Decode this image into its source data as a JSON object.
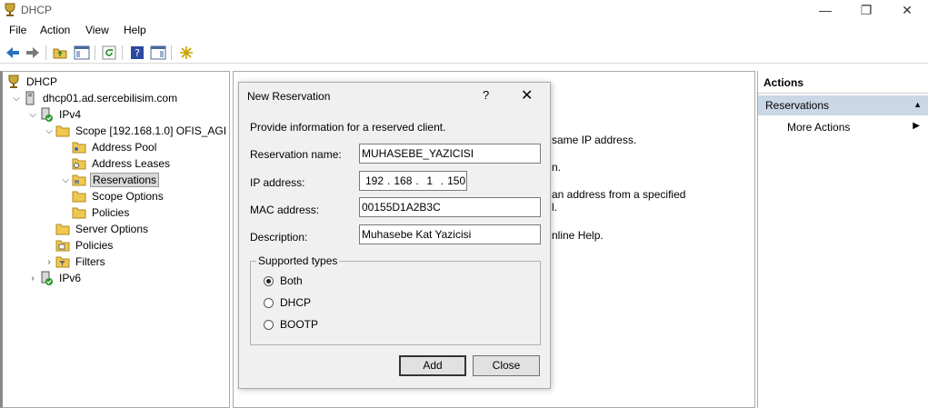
{
  "window": {
    "title": "DHCP",
    "minimize": "—",
    "maximize": "❐",
    "close": "✕"
  },
  "menu": [
    "File",
    "Action",
    "View",
    "Help"
  ],
  "toolbar": [
    "back-icon",
    "forward-icon",
    "up-folder-icon",
    "show-hide-tree-icon",
    "refresh-icon",
    "help-icon",
    "show-hide-action-pane-icon",
    "new-star-icon"
  ],
  "tree": {
    "root": "DHCP",
    "server": "dhcp01.ad.sercebilisim.com",
    "ipv4": "IPv4",
    "scope": "Scope [192.168.1.0] OFIS_AGI",
    "address_pool": "Address Pool",
    "address_leases": "Address Leases",
    "reservations": "Reservations",
    "scope_options": "Scope Options",
    "policies_scope": "Policies",
    "server_options": "Server Options",
    "policies": "Policies",
    "filters": "Filters",
    "ipv6": "IPv6"
  },
  "center_text": {
    "line1": "same IP address.",
    "line2": "n.",
    "line3": "an address from a specified",
    "line4": "l.",
    "line5": "nline Help."
  },
  "actions": {
    "header": "Actions",
    "section": "Reservations",
    "item": "More Actions"
  },
  "dialog": {
    "title": "New Reservation",
    "help": "?",
    "close": "✕",
    "intro": "Provide information for a reserved client.",
    "name_label": "Reservation name:",
    "name_value": "MUHASEBE_YAZICISI",
    "ip_label": "IP address:",
    "ip_octets": [
      "192",
      "168",
      "1",
      "150"
    ],
    "mac_label": "MAC address:",
    "mac_value": "00155D1A2B3C",
    "desc_label": "Description:",
    "desc_value": "Muhasebe Kat Yazicisi",
    "group_title": "Supported types",
    "types": [
      {
        "label": "Both",
        "selected": true
      },
      {
        "label": "DHCP",
        "selected": false
      },
      {
        "label": "BOOTP",
        "selected": false
      }
    ],
    "add_button": "Add",
    "close_button": "Close"
  }
}
